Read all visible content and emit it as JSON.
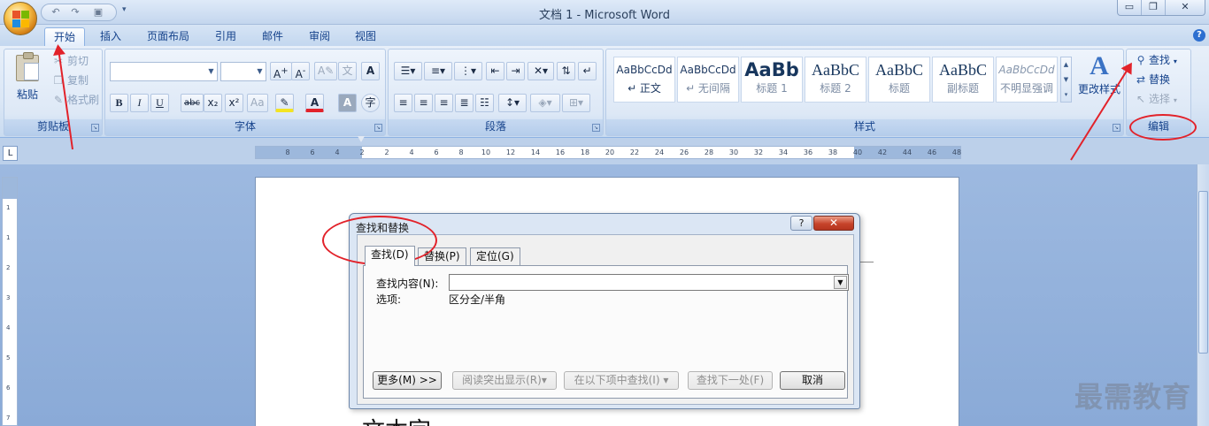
{
  "window": {
    "title": "文档 1 - Microsoft Word",
    "controls": [
      "▭",
      "❐",
      "✕"
    ]
  },
  "quick_access": {
    "save_icon": "save-icon",
    "undo_icon": "undo-icon",
    "redo_icon": "redo-icon"
  },
  "tabs": [
    "开始",
    "插入",
    "页面布局",
    "引用",
    "邮件",
    "审阅",
    "视图"
  ],
  "active_tab": "开始",
  "ribbon": {
    "clipboard": {
      "label": "剪贴板",
      "paste": "粘贴",
      "cut": "剪切",
      "copy": "复制",
      "format_painter": "格式刷"
    },
    "font": {
      "label": "字体",
      "buttons": [
        "B",
        "I",
        "U",
        "abc",
        "x₂",
        "x²",
        "Aa",
        "A",
        "A"
      ]
    },
    "paragraph": {
      "label": "段落"
    },
    "styles": {
      "label": "样式",
      "items": [
        {
          "sample": "AaBbCcDd",
          "name": "↵ 正文"
        },
        {
          "sample": "AaBbCcDd",
          "name": "↵ 无间隔"
        },
        {
          "sample": "AaBb",
          "name": "标题 1"
        },
        {
          "sample": "AaBbC",
          "name": "标题 2"
        },
        {
          "sample": "AaBbC",
          "name": "标题"
        },
        {
          "sample": "AaBbC",
          "name": "副标题"
        },
        {
          "sample": "AaBbCcDd",
          "name": "不明显强调"
        }
      ],
      "change_styles": "更改样式"
    },
    "editing": {
      "label": "编辑",
      "find": "查找",
      "replace": "替换",
      "select": "选择"
    }
  },
  "ruler": {
    "ticks": [
      "8",
      "6",
      "4",
      "2",
      "2",
      "4",
      "6",
      "8",
      "10",
      "12",
      "14",
      "16",
      "18",
      "20",
      "22",
      "24",
      "26",
      "28",
      "30",
      "32",
      "34",
      "36",
      "38",
      "40",
      "42",
      "44",
      "46",
      "48"
    ],
    "vticks": [
      "1",
      "1",
      "2",
      "3",
      "4",
      "5",
      "6",
      "7"
    ]
  },
  "document": {
    "text": "文本字"
  },
  "dialog": {
    "title": "查找和替换",
    "help": "?",
    "close": "✕",
    "tabs": [
      "查找(D)",
      "替换(P)",
      "定位(G)"
    ],
    "find_label": "查找内容(N):",
    "find_value": "",
    "options_label": "选项:",
    "options_value": "区分全/半角",
    "buttons": {
      "more": "更多(M) >>",
      "reading_highlight": "阅读突出显示(R)▾",
      "find_in": "在以下项中查找(I) ▾",
      "find_next": "查找下一处(F)",
      "cancel": "取消"
    }
  },
  "watermark": "最需教育",
  "colors": {
    "annotation": "#e2222a",
    "ribbon_text": "#15428b"
  }
}
